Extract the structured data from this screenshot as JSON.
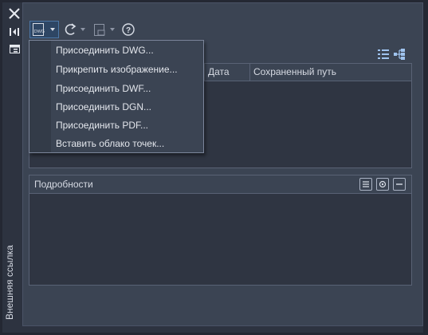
{
  "palette": "Внешняя ссылка",
  "menu": {
    "items": [
      {
        "label": "Присоединить DWG..."
      },
      {
        "label": "Прикрепить изображение..."
      },
      {
        "label": "Присоединить DWF..."
      },
      {
        "label": "Присоединить DGN..."
      },
      {
        "label": "Присоединить PDF..."
      },
      {
        "label": "Вставить облако точек..."
      }
    ]
  },
  "file_refs": {
    "columns": {
      "date": "Дата",
      "saved_path": "Сохраненный путь"
    }
  },
  "details": {
    "title": "Подробности"
  },
  "toolbar": {
    "attach_icon_text": "DWG",
    "help_icon_text": "?"
  }
}
